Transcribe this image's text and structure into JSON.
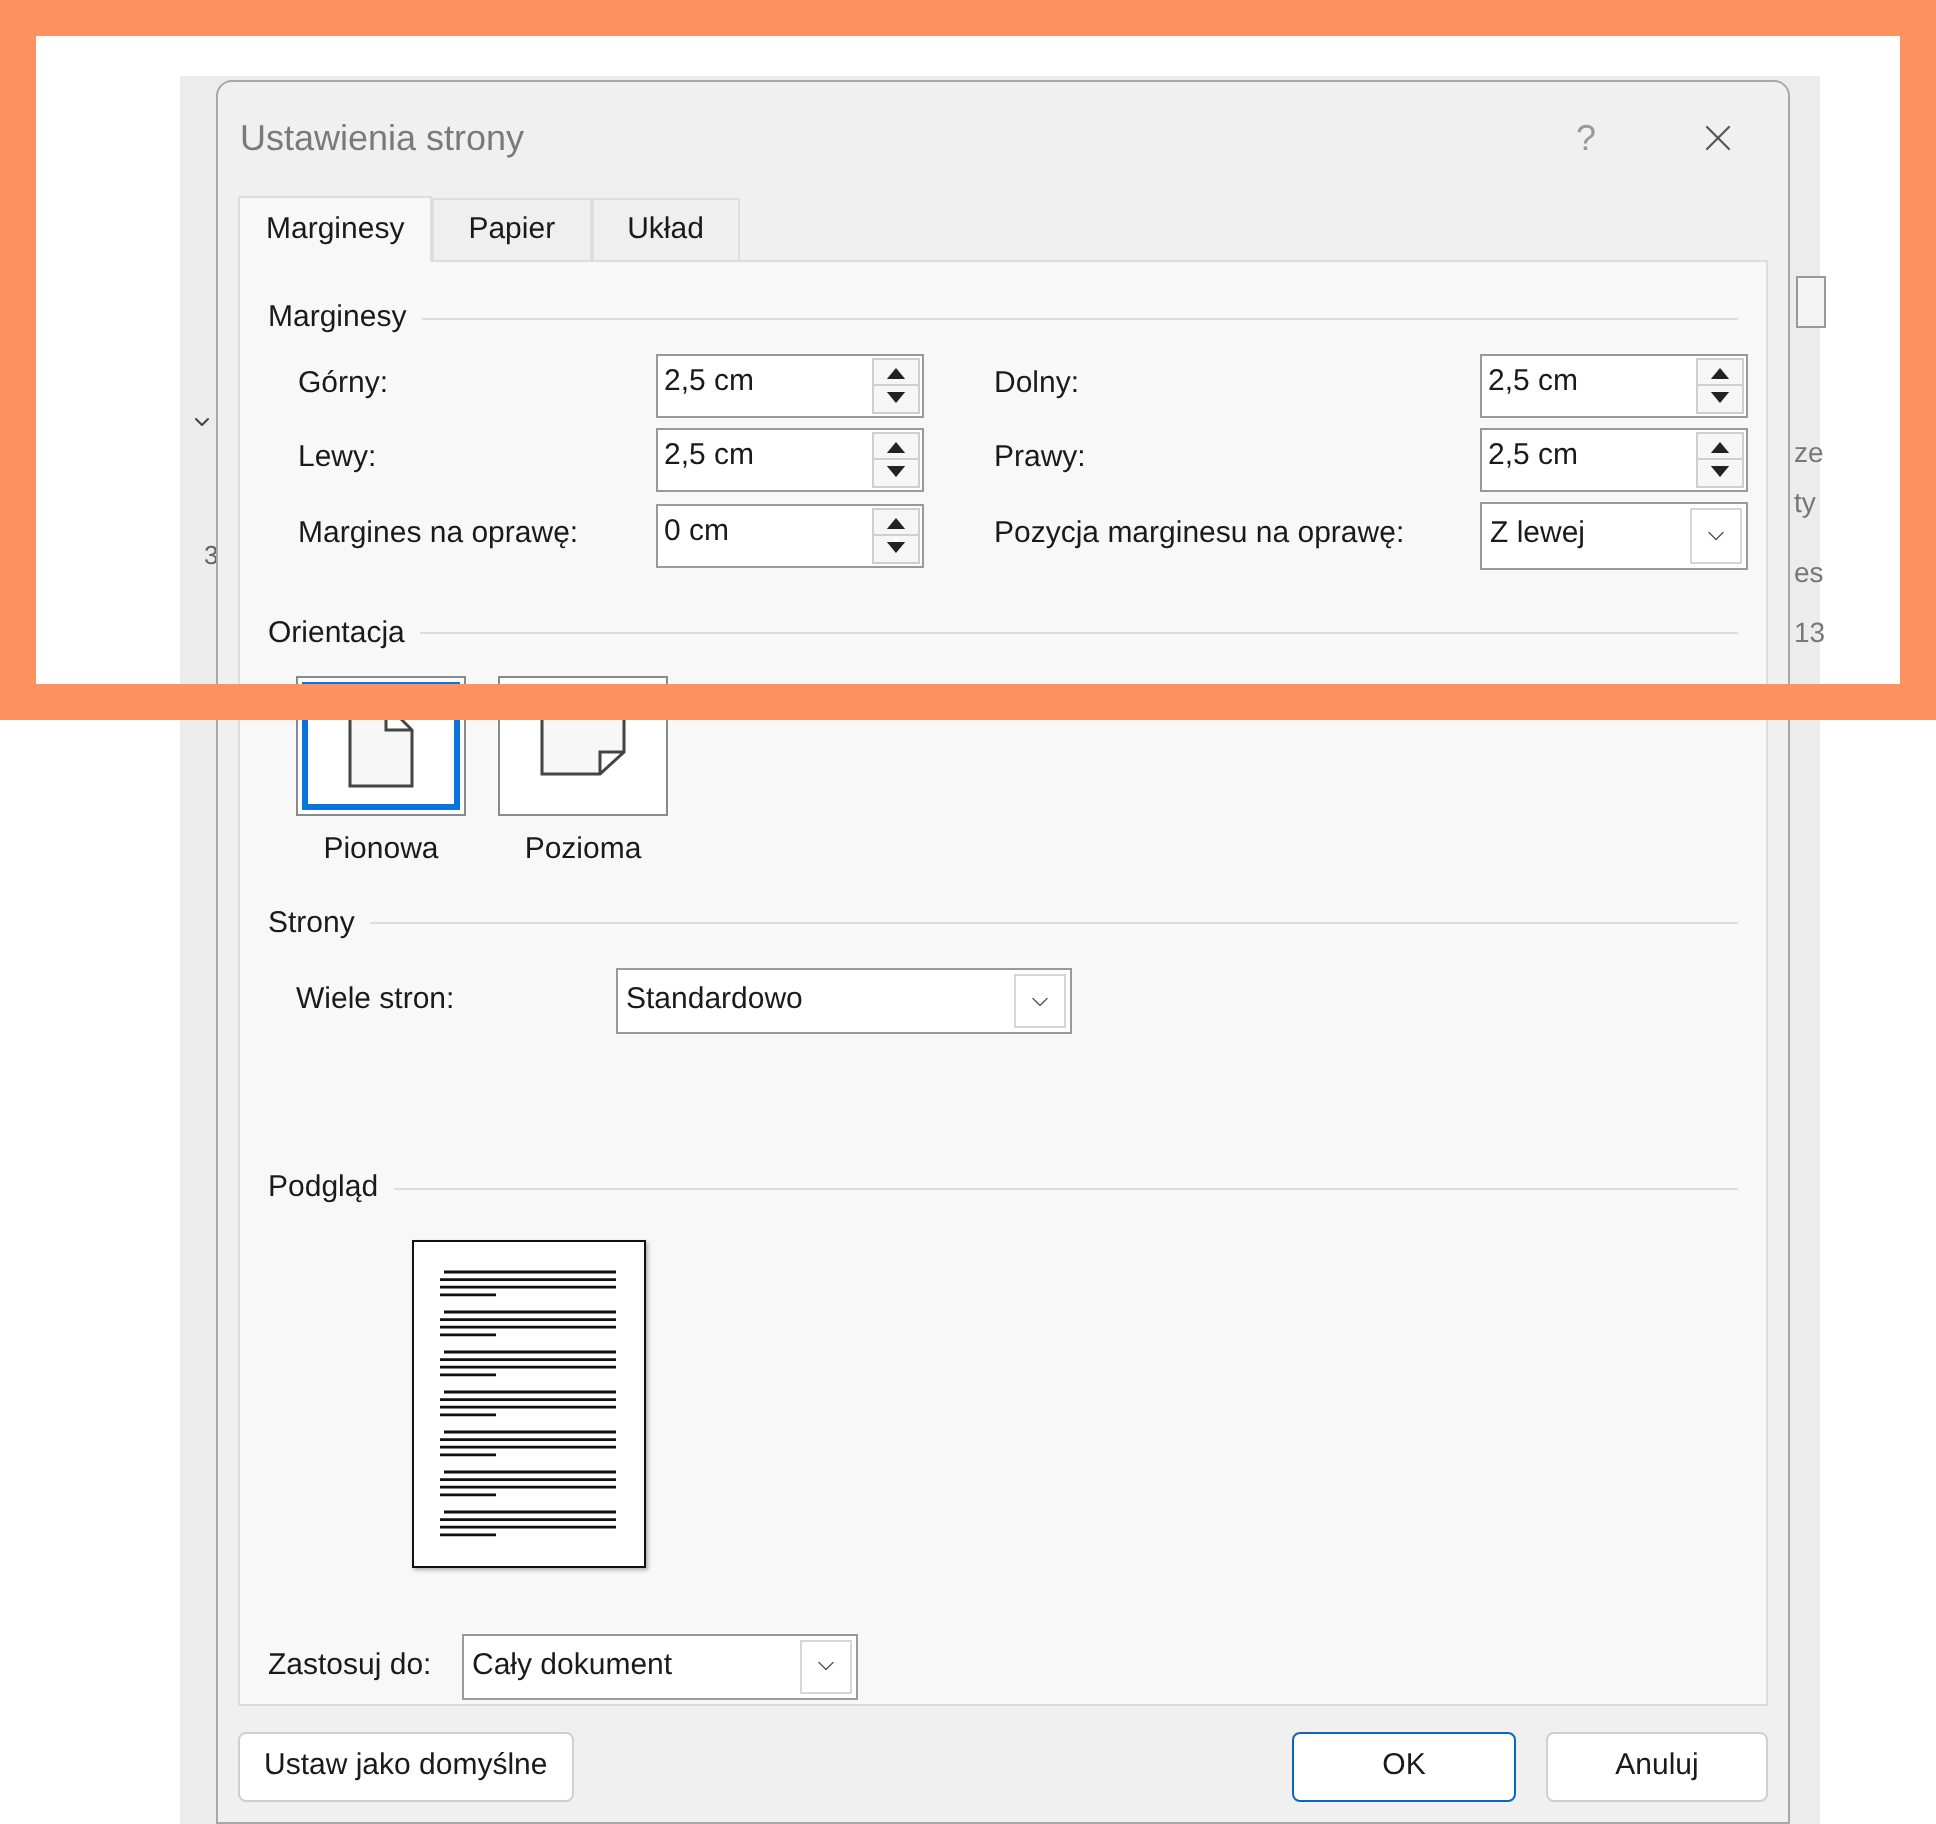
{
  "background": {
    "texts": [
      {
        "kind": "ruler",
        "text": "3"
      },
      {
        "kind": "ribbon",
        "text": "ze"
      },
      {
        "kind": "ribbon",
        "text": "ty"
      },
      {
        "kind": "ribbon",
        "text": "es"
      },
      {
        "kind": "ribbon",
        "text": "13"
      }
    ]
  },
  "window": {
    "title": "Ustawienia strony",
    "help": "?"
  },
  "tabs": [
    {
      "label": "Marginesy",
      "selected": true
    },
    {
      "label": "Papier",
      "selected": false
    },
    {
      "label": "Układ",
      "selected": false
    }
  ],
  "margins": {
    "title": "Marginesy",
    "fields": [
      {
        "label": "Górny:",
        "value": "2,5 cm",
        "kind": "spinner"
      },
      {
        "label": "Dolny:",
        "value": "2,5 cm",
        "kind": "spinner"
      },
      {
        "label": "Lewy:",
        "value": "2,5 cm",
        "kind": "spinner"
      },
      {
        "label": "Prawy:",
        "value": "2,5 cm",
        "kind": "spinner"
      },
      {
        "label": "Margines na oprawę:",
        "value": "0 cm",
        "kind": "spinner"
      },
      {
        "label": "Pozycja marginesu na oprawę:",
        "value": "Z lewej",
        "kind": "select"
      }
    ]
  },
  "orientation": {
    "title": "Orientacja",
    "options": [
      {
        "label": "Pionowa",
        "kind": "portrait",
        "selected": true
      },
      {
        "label": "Pozioma",
        "kind": "landscape",
        "selected": false
      }
    ]
  },
  "pages": {
    "title": "Strony",
    "label": "Wiele stron:",
    "value": "Standardowo"
  },
  "preview": {
    "title": "Podgląd"
  },
  "apply_to": {
    "label": "Zastosuj do:",
    "value": "Cały dokument"
  },
  "buttons": [
    {
      "label": "Ustaw jako domyślne",
      "default": false
    },
    {
      "label": "OK",
      "default": true
    },
    {
      "label": "Anuluj",
      "default": false
    }
  ]
}
